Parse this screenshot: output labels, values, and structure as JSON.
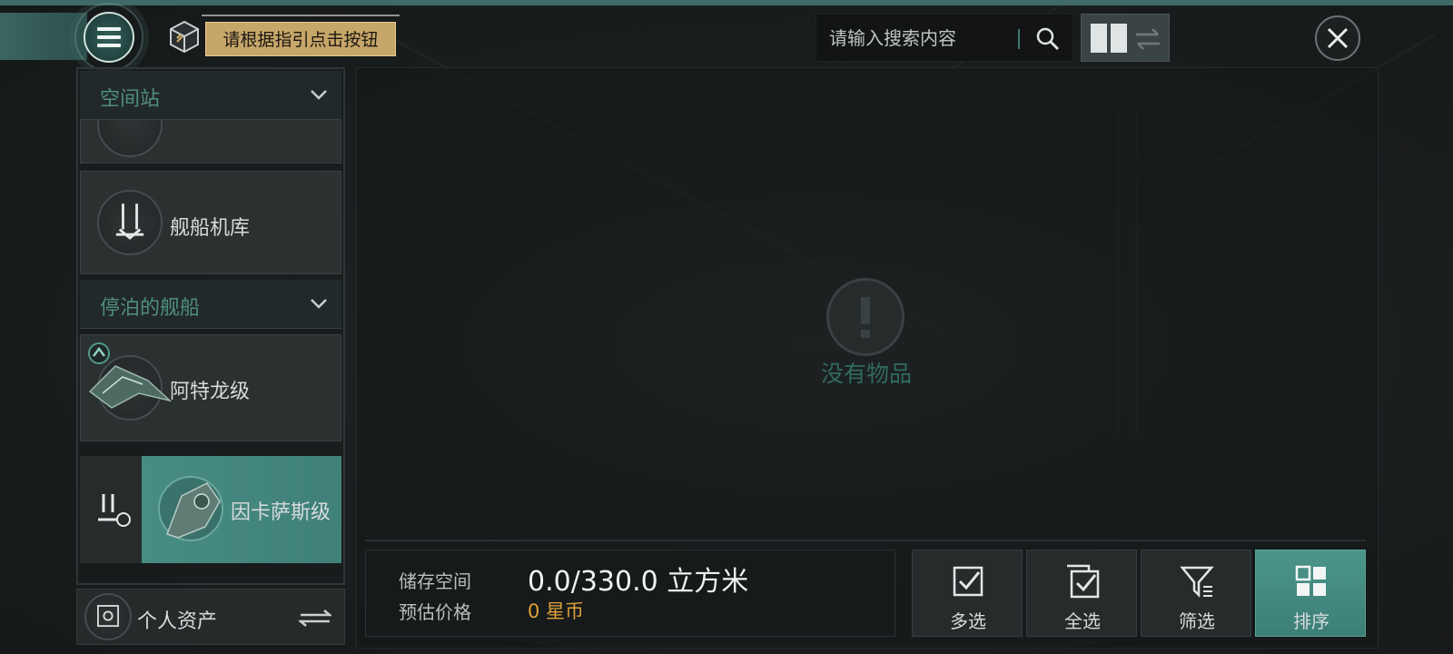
{
  "colors": {
    "accent_teal": "#4b8f86",
    "section_label": "#4f8d80",
    "tooltip_bg": "#c7a66a",
    "price_orange": "#e0a13a",
    "empty_text": "#2f6a60"
  },
  "header": {
    "menu_icon": "hamburger-menu-icon",
    "guide_icon": "cube-icon",
    "tooltip": "请根据指引点击按钮",
    "search": {
      "placeholder": "请输入搜索内容",
      "value": ""
    },
    "view_toggle": {
      "grid_icon": "grid-view-icon",
      "swap_icon": "swap-arrows-icon"
    },
    "close_icon": "close-icon"
  },
  "sidebar": {
    "sections": [
      {
        "label": "空间站",
        "items": [
          {
            "label": "舰船机库",
            "icon": "hangar-icon"
          }
        ]
      },
      {
        "label": "停泊的舰船",
        "items": [
          {
            "label": "阿特龙级",
            "icon": "frigate-ship-icon",
            "badge_icon": "up-arrow-badge-icon"
          },
          {
            "label": "因卡萨斯级",
            "icon": "industrial-ship-icon",
            "selected": true
          }
        ]
      }
    ],
    "footer": {
      "label": "个人资产",
      "icon": "vault-icon",
      "swap_icon": "transfer-icon"
    }
  },
  "main": {
    "empty_state": {
      "icon": "exclamation-icon",
      "text": "没有物品"
    },
    "storage": {
      "capacity_label": "储存空间",
      "capacity_value": "0.0/330.0 立方米",
      "price_label": "预估价格",
      "price_value": "0 星币"
    },
    "actions": [
      {
        "label": "多选",
        "icon": "checkbox-icon"
      },
      {
        "label": "全选",
        "icon": "select-all-icon"
      },
      {
        "label": "筛选",
        "icon": "filter-icon"
      },
      {
        "label": "排序",
        "icon": "sort-grid-icon",
        "active": true
      }
    ]
  }
}
